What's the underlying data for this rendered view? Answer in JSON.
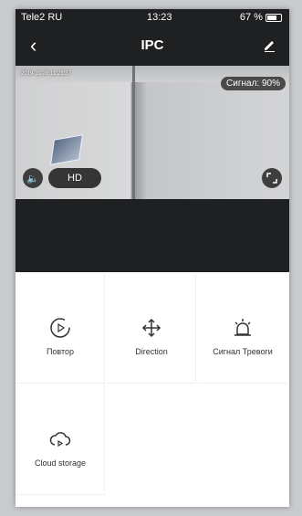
{
  "status_bar": {
    "carrier": "Tele2 RU",
    "time": "13:23",
    "battery": "67 %"
  },
  "nav": {
    "back_icon": "chevron-left-icon",
    "title": "IPC",
    "edit_icon": "pencil-icon"
  },
  "video": {
    "timestamp": "2019-11-28 11:23:37",
    "signal": "Сигнал: 90%",
    "quality": "HD"
  },
  "actions": [
    {
      "label": "Повтор",
      "icon": "playback-icon"
    },
    {
      "label": "Direction",
      "icon": "direction-icon"
    },
    {
      "label": "Сигнал Тревоги",
      "icon": "alarm-icon"
    },
    {
      "label": "Cloud storage",
      "icon": "cloud-icon"
    }
  ]
}
